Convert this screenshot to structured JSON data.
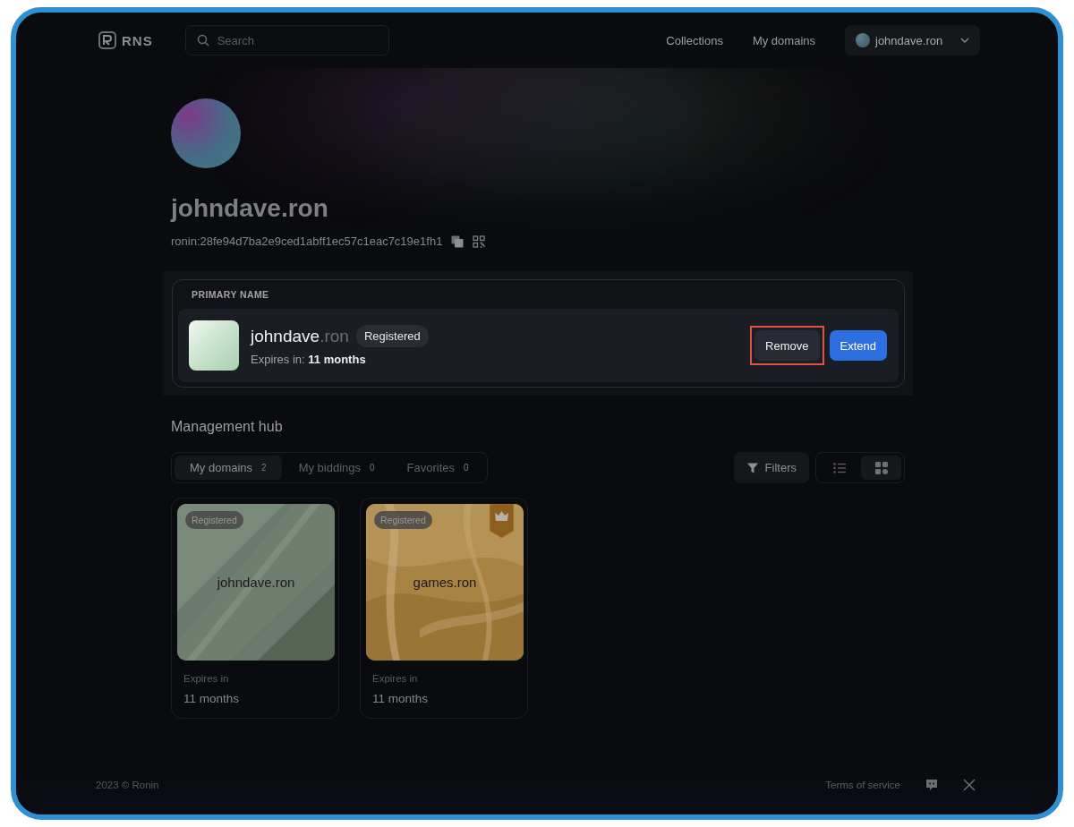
{
  "header": {
    "logo": "RNS",
    "search": {
      "placeholder": "Search"
    },
    "nav": [
      "Collections",
      "My domains"
    ],
    "account": {
      "name": "johndave.ron"
    }
  },
  "profile": {
    "name": "johndave.ron",
    "address": "ronin:28fe94d7ba2e9ced1abff1ec57c1eac7c19e1fh1"
  },
  "primary_name": {
    "heading": "PRIMARY NAME",
    "name": "johndave",
    "suffix": ".ron",
    "badge": "Registered",
    "expires_label": "Expires in:",
    "expires_value": "11 months",
    "actions": [
      {
        "label": "Remove",
        "kind": "secondary",
        "highlighted": true
      },
      {
        "label": "Extend",
        "kind": "primary",
        "highlighted": false
      }
    ]
  },
  "hub": {
    "title": "Management hub",
    "tabs": [
      {
        "label": "My domains",
        "count": "2",
        "selected": true
      },
      {
        "label": "My biddings",
        "count": "0",
        "selected": false
      },
      {
        "label": "Favorites",
        "count": "0",
        "selected": false
      }
    ],
    "filters": "Filters",
    "views": [
      {
        "kind": "list",
        "selected": false
      },
      {
        "kind": "grid",
        "selected": true
      }
    ]
  },
  "domains": [
    {
      "name": "johndave.ron",
      "badge": "Registered",
      "kind": "sage",
      "premium": false,
      "expires_label": "Expires in",
      "expires_value": "11 months"
    },
    {
      "name": "games.ron",
      "badge": "Registered",
      "kind": "gold",
      "premium": true,
      "expires_label": "Expires in",
      "expires_value": "11 months"
    }
  ],
  "footer": {
    "copyright": "2023 © Ronin",
    "links": [
      "Terms of service"
    ]
  }
}
